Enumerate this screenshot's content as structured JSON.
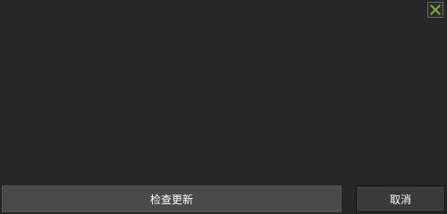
{
  "dialog": {
    "close_icon": "close-x-icon",
    "close_icon_color": "#7aa83c",
    "background_color": "#272727"
  },
  "buttons": {
    "check_update_label": "检查更新",
    "cancel_label": "取消"
  }
}
